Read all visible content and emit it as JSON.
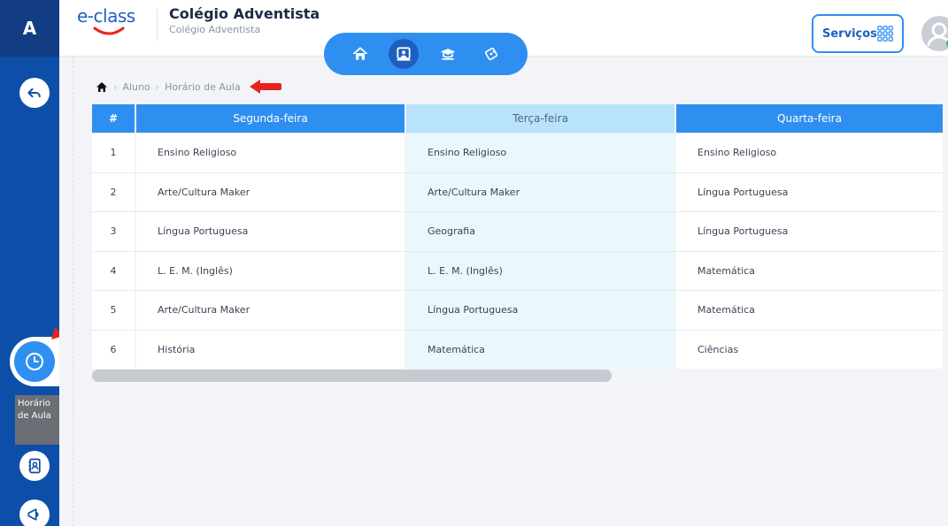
{
  "app": {
    "logo_letter": "A",
    "brand": "e-class",
    "school_name": "Colégio Adventista",
    "school_subtitle": "Colégio Adventista",
    "services_label": "Serviços"
  },
  "nav": {
    "icons": [
      "home-icon",
      "board-icon",
      "graduation-icon",
      "puzzle-icon"
    ],
    "active_index": 1
  },
  "sidebar": {
    "back_icon": "back-arrow-icon",
    "clock_icon": "clock-icon",
    "tooltip": "Horário de Aula",
    "contacts_icon": "contacts-icon",
    "megaphone_icon": "megaphone-icon"
  },
  "breadcrumb": {
    "items": [
      "Aluno",
      "Horário de Aula"
    ]
  },
  "table": {
    "headers": [
      "#",
      "Segunda-feira",
      "Terça-feira",
      "Quarta-feira"
    ],
    "rows": [
      [
        "1",
        "Ensino Religioso",
        "Ensino Religioso",
        "Ensino Religioso"
      ],
      [
        "2",
        "Arte/Cultura Maker",
        "Arte/Cultura Maker",
        "Língua Portuguesa"
      ],
      [
        "3",
        "Língua Portuguesa",
        "Geografia",
        "Língua Portuguesa"
      ],
      [
        "4",
        "L. E. M. (Inglês)",
        "L. E. M. (Inglês)",
        "Matemática"
      ],
      [
        "5",
        "Arte/Cultura Maker",
        "Língua Portuguesa",
        "Matemática"
      ],
      [
        "6",
        "História",
        "Matemática",
        "Ciências"
      ]
    ]
  },
  "colors": {
    "sidebar": "#0d4fa8",
    "accent": "#2f8ff0",
    "highlight_column": "#b9e3fb",
    "annotation_arrow": "#e8231d"
  }
}
